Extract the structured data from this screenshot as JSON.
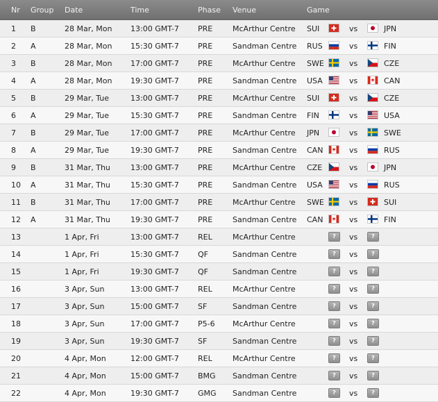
{
  "headers": {
    "nr": "Nr",
    "group": "Group",
    "date": "Date",
    "time": "Time",
    "phase": "Phase",
    "venue": "Venue",
    "game": "Game"
  },
  "vs_label": "vs",
  "unknown_label": "?",
  "games": [
    {
      "nr": "1",
      "group": "B",
      "date": "28 Mar, Mon",
      "time": "13:00 GMT-7",
      "phase": "PRE",
      "venue": "McArthur Centre",
      "team1": "SUI",
      "team2": "JPN"
    },
    {
      "nr": "2",
      "group": "A",
      "date": "28 Mar, Mon",
      "time": "15:30 GMT-7",
      "phase": "PRE",
      "venue": "Sandman Centre",
      "team1": "RUS",
      "team2": "FIN"
    },
    {
      "nr": "3",
      "group": "B",
      "date": "28 Mar, Mon",
      "time": "17:00 GMT-7",
      "phase": "PRE",
      "venue": "McArthur Centre",
      "team1": "SWE",
      "team2": "CZE"
    },
    {
      "nr": "4",
      "group": "A",
      "date": "28 Mar, Mon",
      "time": "19:30 GMT-7",
      "phase": "PRE",
      "venue": "Sandman Centre",
      "team1": "USA",
      "team2": "CAN"
    },
    {
      "nr": "5",
      "group": "B",
      "date": "29 Mar, Tue",
      "time": "13:00 GMT-7",
      "phase": "PRE",
      "venue": "McArthur Centre",
      "team1": "SUI",
      "team2": "CZE"
    },
    {
      "nr": "6",
      "group": "A",
      "date": "29 Mar, Tue",
      "time": "15:30 GMT-7",
      "phase": "PRE",
      "venue": "Sandman Centre",
      "team1": "FIN",
      "team2": "USA"
    },
    {
      "nr": "7",
      "group": "B",
      "date": "29 Mar, Tue",
      "time": "17:00 GMT-7",
      "phase": "PRE",
      "venue": "McArthur Centre",
      "team1": "JPN",
      "team2": "SWE"
    },
    {
      "nr": "8",
      "group": "A",
      "date": "29 Mar, Tue",
      "time": "19:30 GMT-7",
      "phase": "PRE",
      "venue": "Sandman Centre",
      "team1": "CAN",
      "team2": "RUS"
    },
    {
      "nr": "9",
      "group": "B",
      "date": "31 Mar, Thu",
      "time": "13:00 GMT-7",
      "phase": "PRE",
      "venue": "McArthur Centre",
      "team1": "CZE",
      "team2": "JPN"
    },
    {
      "nr": "10",
      "group": "A",
      "date": "31 Mar, Thu",
      "time": "15:30 GMT-7",
      "phase": "PRE",
      "venue": "Sandman Centre",
      "team1": "USA",
      "team2": "RUS"
    },
    {
      "nr": "11",
      "group": "B",
      "date": "31 Mar, Thu",
      "time": "17:00 GMT-7",
      "phase": "PRE",
      "venue": "McArthur Centre",
      "team1": "SWE",
      "team2": "SUI"
    },
    {
      "nr": "12",
      "group": "A",
      "date": "31 Mar, Thu",
      "time": "19:30 GMT-7",
      "phase": "PRE",
      "venue": "Sandman Centre",
      "team1": "CAN",
      "team2": "FIN"
    },
    {
      "nr": "13",
      "group": "",
      "date": "1 Apr, Fri",
      "time": "13:00 GMT-7",
      "phase": "REL",
      "venue": "McArthur Centre",
      "team1": "",
      "team2": ""
    },
    {
      "nr": "14",
      "group": "",
      "date": "1 Apr, Fri",
      "time": "15:30 GMT-7",
      "phase": "QF",
      "venue": "Sandman Centre",
      "team1": "",
      "team2": ""
    },
    {
      "nr": "15",
      "group": "",
      "date": "1 Apr, Fri",
      "time": "19:30 GMT-7",
      "phase": "QF",
      "venue": "Sandman Centre",
      "team1": "",
      "team2": ""
    },
    {
      "nr": "16",
      "group": "",
      "date": "3 Apr, Sun",
      "time": "13:00 GMT-7",
      "phase": "REL",
      "venue": "McArthur Centre",
      "team1": "",
      "team2": ""
    },
    {
      "nr": "17",
      "group": "",
      "date": "3 Apr, Sun",
      "time": "15:00 GMT-7",
      "phase": "SF",
      "venue": "Sandman Centre",
      "team1": "",
      "team2": ""
    },
    {
      "nr": "18",
      "group": "",
      "date": "3 Apr, Sun",
      "time": "17:00 GMT-7",
      "phase": "P5-6",
      "venue": "McArthur Centre",
      "team1": "",
      "team2": ""
    },
    {
      "nr": "19",
      "group": "",
      "date": "3 Apr, Sun",
      "time": "19:30 GMT-7",
      "phase": "SF",
      "venue": "Sandman Centre",
      "team1": "",
      "team2": ""
    },
    {
      "nr": "20",
      "group": "",
      "date": "4 Apr, Mon",
      "time": "12:00 GMT-7",
      "phase": "REL",
      "venue": "McArthur Centre",
      "team1": "",
      "team2": ""
    },
    {
      "nr": "21",
      "group": "",
      "date": "4 Apr, Mon",
      "time": "15:00 GMT-7",
      "phase": "BMG",
      "venue": "Sandman Centre",
      "team1": "",
      "team2": ""
    },
    {
      "nr": "22",
      "group": "",
      "date": "4 Apr, Mon",
      "time": "19:30 GMT-7",
      "phase": "GMG",
      "venue": "Sandman Centre",
      "team1": "",
      "team2": ""
    }
  ]
}
